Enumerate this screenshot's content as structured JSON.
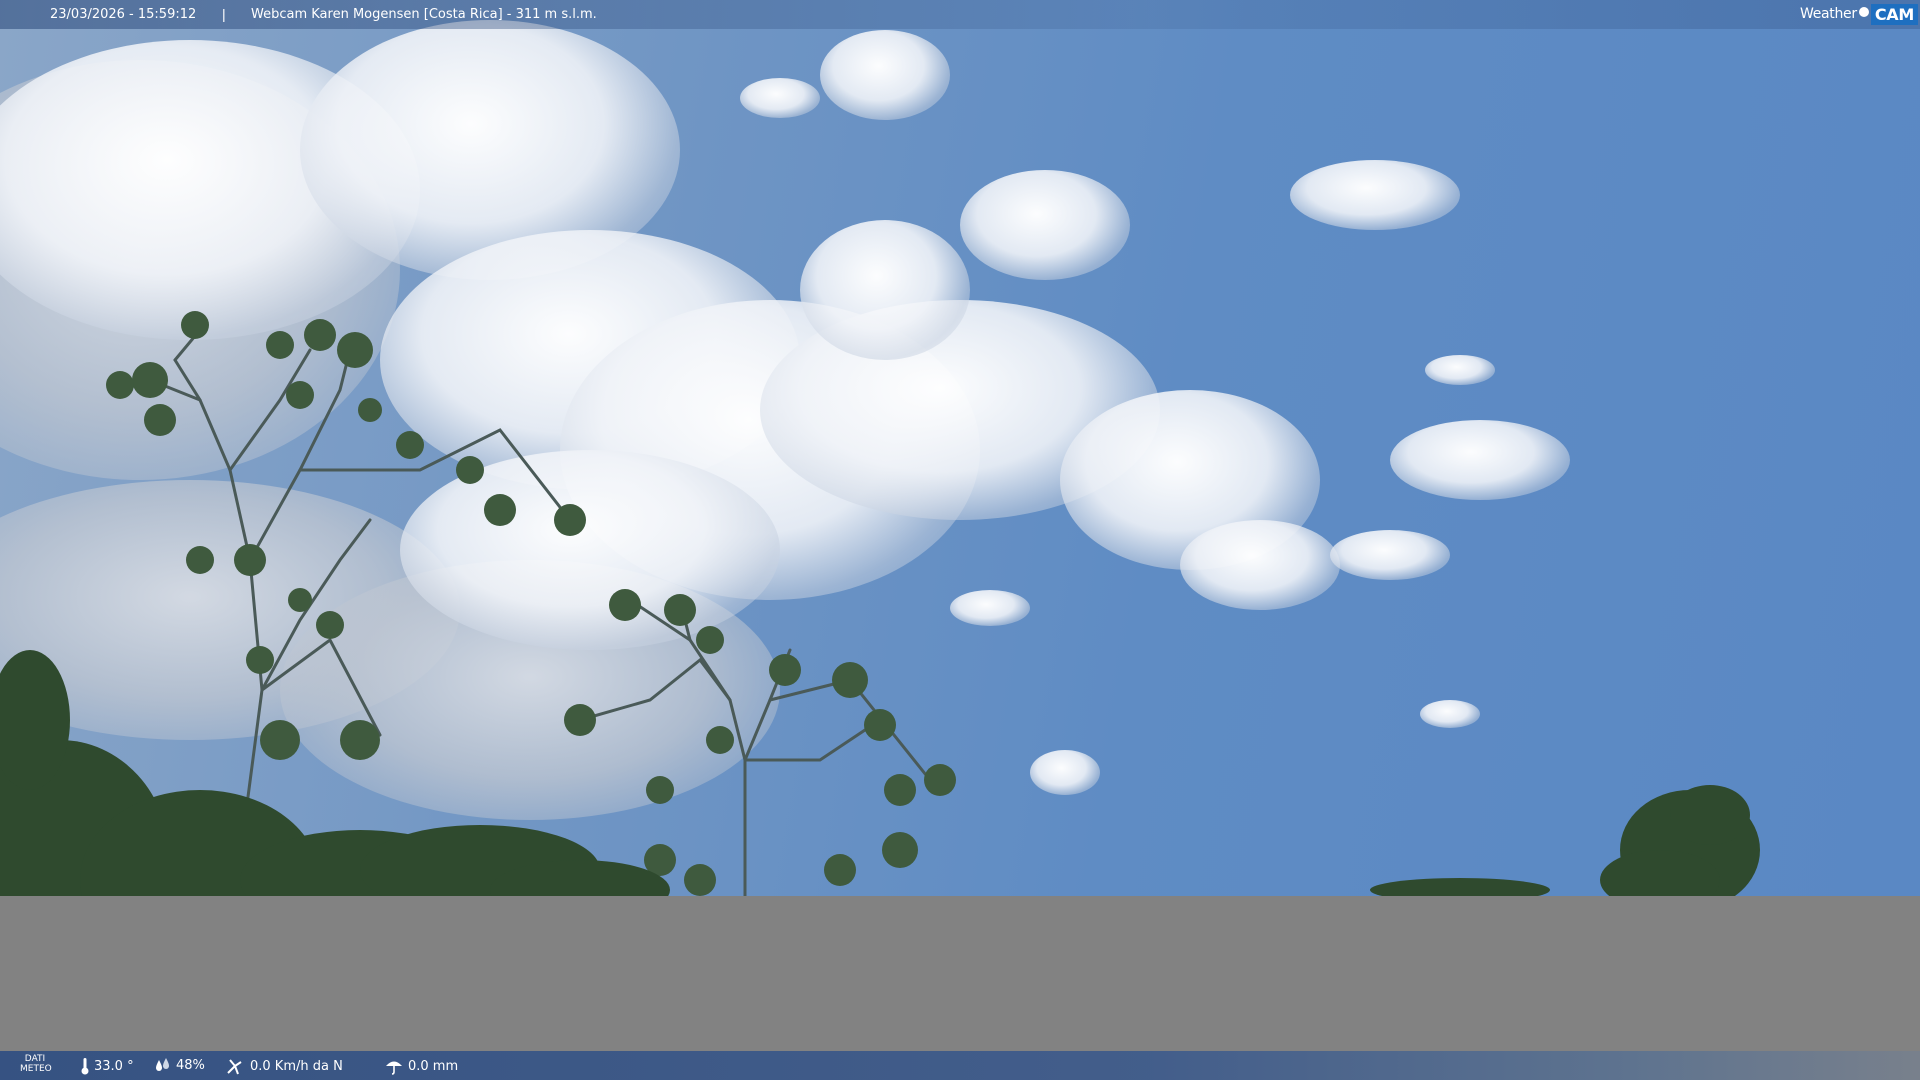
{
  "topbar": {
    "timestamp": "23/03/2026 - 15:59:12",
    "separator": "|",
    "title": "Webcam Karen Mogensen [Costa Rica]  - 311 m s.l.m."
  },
  "logo": {
    "weather": "Weather",
    "cam": "CAM"
  },
  "bottombar": {
    "meteo_line1": "DATI",
    "meteo_line2": "METEO",
    "temperature": "33.0 °",
    "humidity": "48%",
    "wind": "0.0 Km/h da N",
    "rain": "0.0 mm"
  },
  "icons": [
    "thermometer-icon",
    "humidity-icon",
    "wind-icon",
    "rain-icon"
  ],
  "colors": {
    "sky": "#5f8cc4",
    "ground": "#828282",
    "bar": "#325082",
    "logo_accent": "#1e6fc0"
  }
}
